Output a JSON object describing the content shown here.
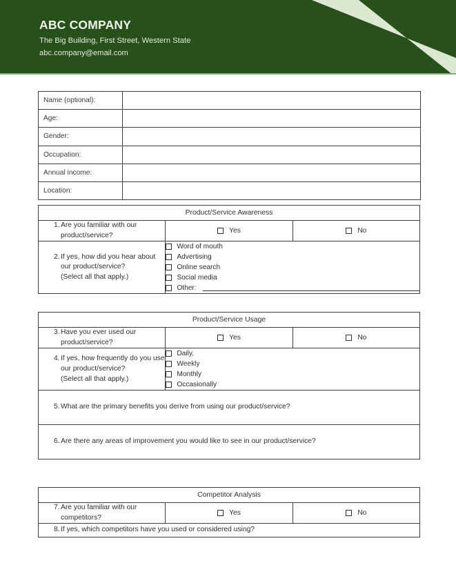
{
  "header": {
    "company_name": "ABC COMPANY",
    "address": "The Big Building, First Street, Western State",
    "email": "abc.company@email.com",
    "bg_color": "#27501a",
    "stripe_color": "#dde8d2",
    "text_color": "#f2f6ec"
  },
  "demographics": {
    "rows": [
      {
        "label": "Name (optional):",
        "value": ""
      },
      {
        "label": "Age:",
        "value": ""
      },
      {
        "label": "Gender:",
        "value": ""
      },
      {
        "label": "Occupation:",
        "value": ""
      },
      {
        "label": "Annual income:",
        "value": ""
      },
      {
        "label": "Location:",
        "value": ""
      }
    ]
  },
  "sections": [
    {
      "title": "Product/Service Awareness",
      "questions": [
        {
          "number": "1.",
          "lines": [
            "Are you familiar with our product/service?"
          ],
          "answer_type": "yesno",
          "yes_label": "Yes",
          "no_label": "No"
        },
        {
          "number": "2.",
          "lines": [
            "If yes, how did you hear about our product/service?",
            "(Select all that apply.)"
          ],
          "answer_type": "checklist",
          "options": [
            {
              "label": "Word of mouth",
              "blank": false
            },
            {
              "label": "Advertising",
              "blank": false
            },
            {
              "label": "Online search",
              "blank": false
            },
            {
              "label": "Social media",
              "blank": false
            },
            {
              "label": "Other:",
              "blank": true
            }
          ]
        }
      ]
    },
    {
      "title": "Product/Service Usage",
      "questions": [
        {
          "number": "3.",
          "lines": [
            "Have you ever used our product/service?"
          ],
          "answer_type": "yesno",
          "yes_label": "Yes",
          "no_label": "No"
        },
        {
          "number": "4.",
          "lines": [
            "If yes, how frequently do you use our product/service?",
            "(Select all that apply.)"
          ],
          "answer_type": "checklist",
          "options": [
            {
              "label": "Daily,",
              "blank": false
            },
            {
              "label": "Weekly",
              "blank": false
            },
            {
              "label": "Monthly",
              "blank": false
            },
            {
              "label": "Occasionally",
              "blank": false
            }
          ]
        },
        {
          "number": "5.",
          "lines": [
            "What are the primary benefits you derive from using our product/service?"
          ],
          "answer_type": "open"
        },
        {
          "number": "6.",
          "lines": [
            "Are there any areas of improvement you would like to see in our product/service?"
          ],
          "answer_type": "open"
        }
      ]
    },
    {
      "title": "Competitor Analysis",
      "questions": [
        {
          "number": "7.",
          "lines": [
            "Are you familiar with our competitors?"
          ],
          "answer_type": "yesno",
          "yes_label": "Yes",
          "no_label": "No"
        },
        {
          "number": "8.",
          "lines": [
            "If yes, which competitors have you used or considered using?"
          ],
          "answer_type": "open_short"
        }
      ]
    }
  ]
}
